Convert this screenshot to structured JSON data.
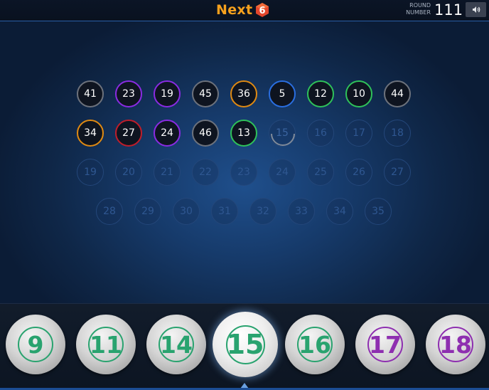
{
  "header": {
    "brand": "Next",
    "brand_badge": "6",
    "round_label_line1": "ROUND",
    "round_label_line2": "NUMBER",
    "round_number": "111",
    "sound_icon": "speaker-icon"
  },
  "colors": {
    "gray": "#6d727c",
    "purple": "#8a2be2",
    "orange": "#e08a12",
    "blue": "#2a6ee0",
    "green": "#2fc25a",
    "red": "#c01d2a",
    "ring_green": "#29a36f",
    "ring_purple": "#8e2fb0"
  },
  "drawn_balls": [
    {
      "n": "41",
      "color": "gray"
    },
    {
      "n": "23",
      "color": "purple"
    },
    {
      "n": "19",
      "color": "purple"
    },
    {
      "n": "45",
      "color": "gray"
    },
    {
      "n": "36",
      "color": "orange"
    },
    {
      "n": "5",
      "color": "blue"
    },
    {
      "n": "12",
      "color": "green"
    },
    {
      "n": "10",
      "color": "green"
    },
    {
      "n": "44",
      "color": "gray"
    },
    {
      "n": "34",
      "color": "orange"
    },
    {
      "n": "27",
      "color": "red"
    },
    {
      "n": "24",
      "color": "purple"
    },
    {
      "n": "46",
      "color": "gray"
    },
    {
      "n": "13",
      "color": "green"
    }
  ],
  "current_slot": "15",
  "empty_slots": [
    "16",
    "17",
    "18",
    "19",
    "20",
    "21",
    "22",
    "23",
    "24",
    "25",
    "26",
    "27",
    "28",
    "29",
    "30",
    "31",
    "32",
    "33",
    "34",
    "35"
  ],
  "bet_balls": [
    {
      "n": "9",
      "color": "ring_green"
    },
    {
      "n": "11",
      "color": "ring_green"
    },
    {
      "n": "14",
      "color": "ring_green"
    },
    {
      "n": "15",
      "color": "ring_green",
      "active": true
    },
    {
      "n": "16",
      "color": "ring_green"
    },
    {
      "n": "17",
      "color": "ring_purple"
    },
    {
      "n": "18",
      "color": "ring_purple"
    }
  ]
}
